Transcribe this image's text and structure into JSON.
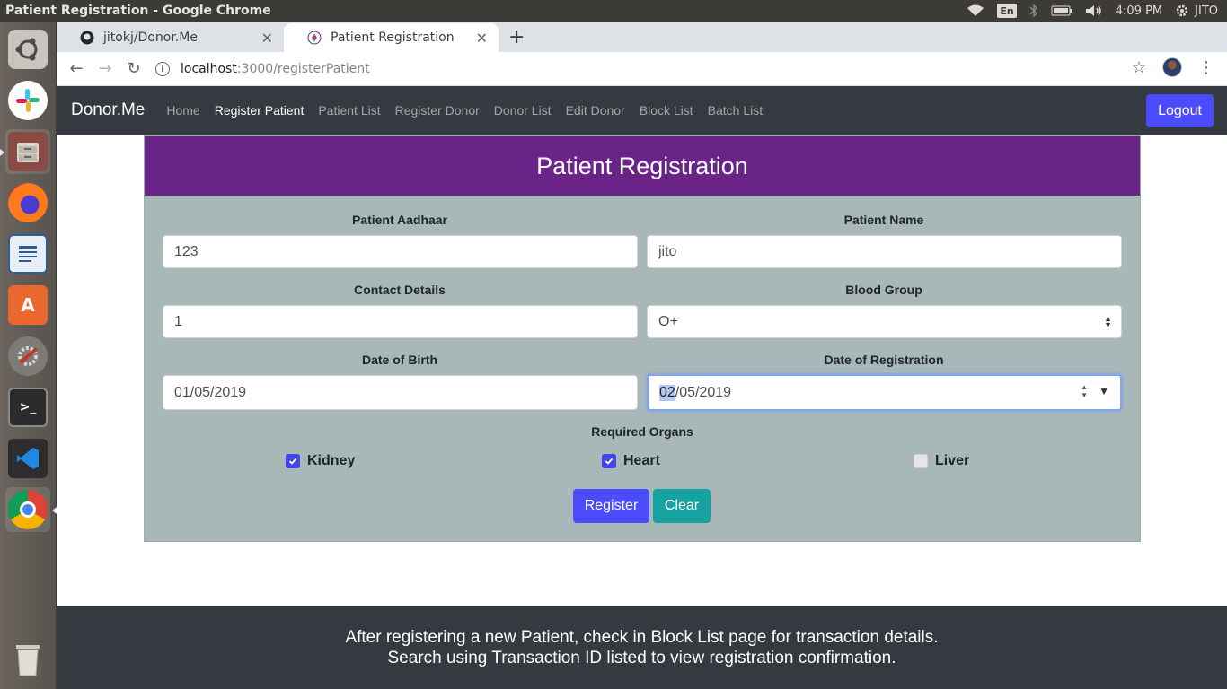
{
  "os": {
    "window_title": "Patient Registration - Google Chrome",
    "tray": {
      "keyboard": "En",
      "time": "4:09 PM",
      "user": "JITO"
    }
  },
  "launcher": {
    "apps": [
      "ubuntu-dash",
      "slack",
      "files",
      "firefox",
      "libreoffice-writer",
      "software-center",
      "system-settings",
      "terminal",
      "vscode",
      "chrome",
      "trash"
    ]
  },
  "browser": {
    "tabs": [
      {
        "title": "jitokj/Donor.Me",
        "icon": "github-icon"
      },
      {
        "title": "Patient Registration",
        "icon": "app-favicon"
      }
    ],
    "url_host": "localhost",
    "url_path": ":3000/registerPatient"
  },
  "app": {
    "brand": "Donor.Me",
    "nav": [
      "Home",
      "Register Patient",
      "Patient List",
      "Register Donor",
      "Donor List",
      "Edit Donor",
      "Block List",
      "Batch List"
    ],
    "logout": "Logout",
    "form": {
      "title": "Patient Registration",
      "aadhaar_label": "Patient Aadhaar",
      "aadhaar_value": "123",
      "name_label": "Patient Name",
      "name_value": "jito",
      "contact_label": "Contact Details",
      "contact_value": "1",
      "blood_label": "Blood Group",
      "blood_value": "O+",
      "dob_label": "Date of Birth",
      "dob_value": "01/05/2019",
      "dor_label": "Date of Registration",
      "dor_day": "02",
      "dor_rest": "/05/2019",
      "organs_label": "Required Organs",
      "organs": [
        {
          "label": "Kidney",
          "checked": true
        },
        {
          "label": "Heart",
          "checked": true
        },
        {
          "label": "Liver",
          "checked": false
        }
      ],
      "register": "Register",
      "clear": "Clear"
    },
    "footer": {
      "line1": "After registering a new Patient, check in Block List page for transaction details.",
      "line2": "Search using Transaction ID listed to view registration confirmation."
    }
  }
}
